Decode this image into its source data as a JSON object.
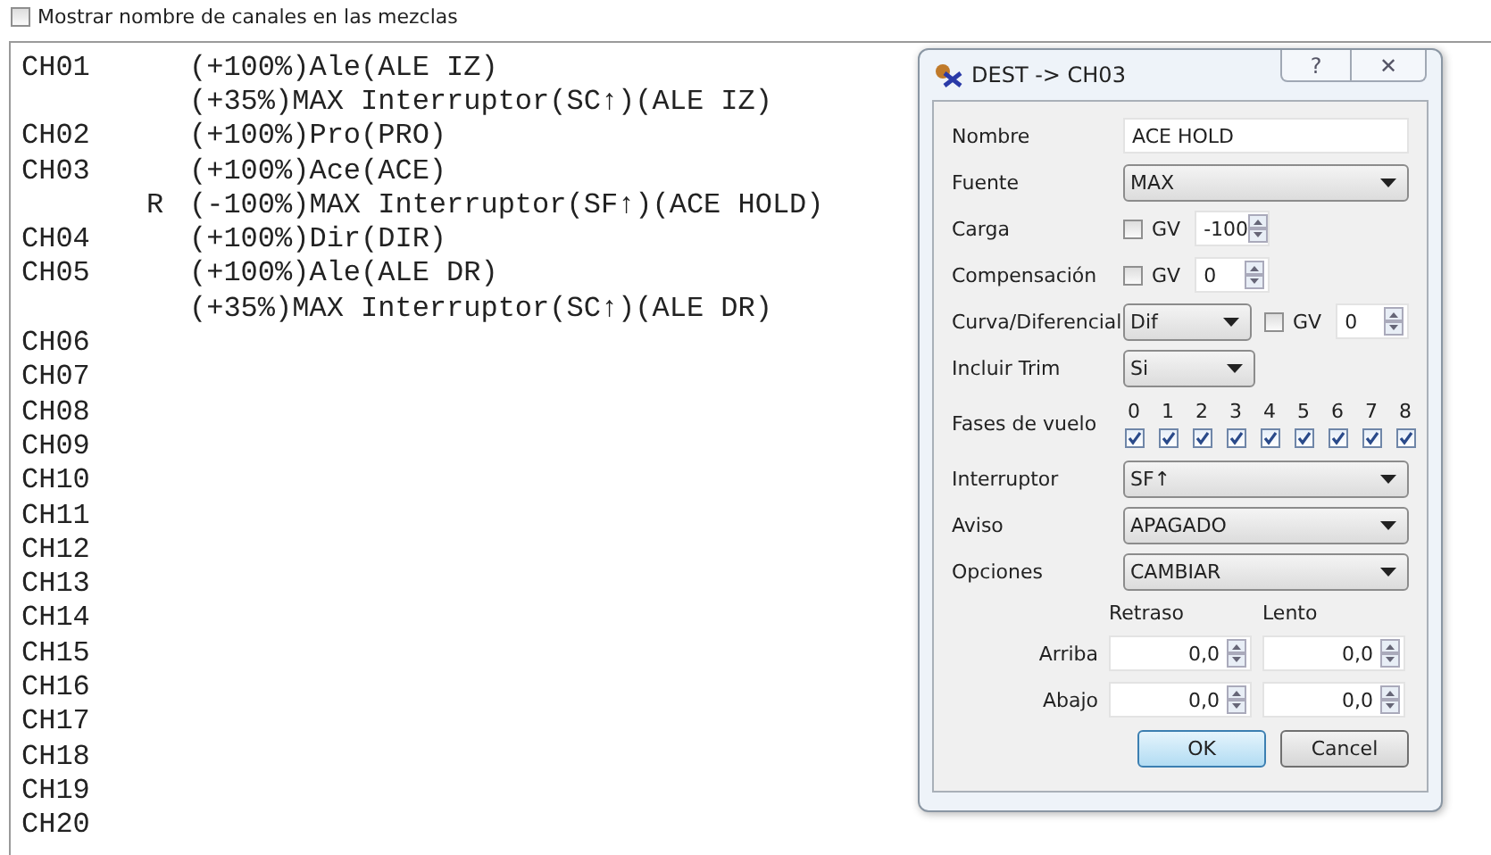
{
  "show_names": {
    "label": "Mostrar nombre de canales en las mezclas",
    "checked": false
  },
  "channels": [
    {
      "name": "CH01",
      "mixes": [
        {
          "text": "(+100%)Ale(ALE IZ)"
        },
        {
          "text": "(+35%)MAX Interruptor(SC↑)(ALE IZ)"
        }
      ]
    },
    {
      "name": "CH02",
      "mixes": [
        {
          "text": "(+100%)Pro(PRO)"
        }
      ]
    },
    {
      "name": "CH03",
      "mixes": [
        {
          "text": "(+100%)Ace(ACE)"
        },
        {
          "mode": "R",
          "text": "(-100%)MAX Interruptor(SF↑)(ACE HOLD)"
        }
      ]
    },
    {
      "name": "CH04",
      "mixes": [
        {
          "text": "(+100%)Dir(DIR)"
        }
      ]
    },
    {
      "name": "CH05",
      "mixes": [
        {
          "text": "(+100%)Ale(ALE DR)"
        },
        {
          "text": "(+35%)MAX Interruptor(SC↑)(ALE DR)"
        }
      ]
    },
    {
      "name": "CH06"
    },
    {
      "name": "CH07"
    },
    {
      "name": "CH08"
    },
    {
      "name": "CH09"
    },
    {
      "name": "CH10"
    },
    {
      "name": "CH11"
    },
    {
      "name": "CH12"
    },
    {
      "name": "CH13"
    },
    {
      "name": "CH14"
    },
    {
      "name": "CH15"
    },
    {
      "name": "CH16"
    },
    {
      "name": "CH17"
    },
    {
      "name": "CH18"
    },
    {
      "name": "CH19"
    },
    {
      "name": "CH20"
    }
  ],
  "dialog": {
    "title": "DEST -> CH03",
    "help": "?",
    "close": "✕",
    "fields": [
      {
        "kind": "text",
        "label": "Nombre",
        "value": "ACE HOLD"
      },
      {
        "kind": "dropdown",
        "label": "Fuente",
        "value": "MAX"
      },
      {
        "kind": "gvspin",
        "label": "Carga",
        "gv": {
          "label": "GV",
          "checked": false
        },
        "value": "-100"
      },
      {
        "kind": "gvspin",
        "label": "Compensación",
        "gv": {
          "label": "GV",
          "checked": false
        },
        "value": "0"
      },
      {
        "kind": "curve",
        "label": "Curva/Diferencial",
        "choice": "Dif",
        "gv": {
          "label": "GV",
          "checked": false
        },
        "value": "0"
      },
      {
        "kind": "short",
        "label": "Incluir Trim",
        "value": "Si"
      },
      {
        "kind": "phases",
        "label": "Fases de vuelo",
        "phases": [
          {
            "label": "0",
            "checked": true
          },
          {
            "label": "1",
            "checked": true
          },
          {
            "label": "2",
            "checked": true
          },
          {
            "label": "3",
            "checked": true
          },
          {
            "label": "4",
            "checked": true
          },
          {
            "label": "5",
            "checked": true
          },
          {
            "label": "6",
            "checked": true
          },
          {
            "label": "7",
            "checked": true
          },
          {
            "label": "8",
            "checked": true
          }
        ]
      },
      {
        "kind": "dropdown",
        "label": "Interruptor",
        "value": "SF↑"
      },
      {
        "kind": "dropdown",
        "label": "Aviso",
        "value": "APAGADO"
      },
      {
        "kind": "dropdown",
        "label": "Opciones",
        "value": "CAMBIAR"
      }
    ],
    "timing": {
      "columns": [
        "Retraso",
        "Lento"
      ],
      "rows": [
        {
          "label": "Arriba",
          "values": [
            "0,0",
            "0,0"
          ]
        },
        {
          "label": "Abajo",
          "values": [
            "0,0",
            "0,0"
          ]
        }
      ]
    },
    "buttons": [
      {
        "label": "OK",
        "default": true
      },
      {
        "label": "Cancel",
        "default": false
      }
    ]
  }
}
